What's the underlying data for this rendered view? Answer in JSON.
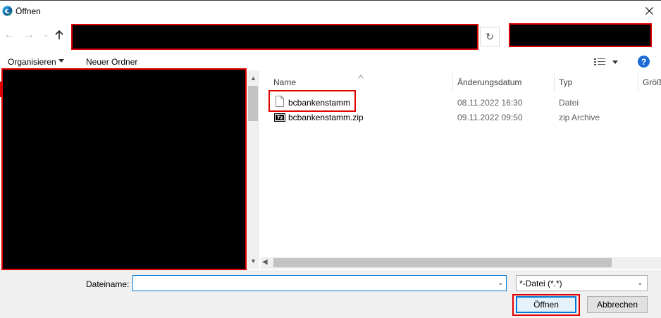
{
  "window": {
    "title": "Öffnen",
    "app_icon": "edge-browser-icon",
    "close_icon": "close-icon"
  },
  "nav": {
    "back_icon": "arrow-left-icon",
    "forward_icon": "arrow-right-icon",
    "recent_icon": "chevron-down-icon",
    "up_icon": "arrow-up-icon",
    "refresh_icon": "refresh-icon",
    "address_redacted": true,
    "search_redacted": true
  },
  "toolbar": {
    "organize_label": "Organisieren",
    "new_folder_label": "Neuer Ordner",
    "view_icon": "details-view-icon",
    "help_label": "?"
  },
  "columns": {
    "name": "Name",
    "date": "Änderungsdatum",
    "type": "Typ",
    "size": "Größe"
  },
  "files": [
    {
      "name": "bcbankenstamm",
      "date": "08.11.2022 16:30",
      "type": "Datei",
      "icon": "file-icon",
      "highlighted": true
    },
    {
      "name": "bcbankenstamm.zip",
      "date": "09.11.2022 09:50",
      "type": "zip Archive",
      "icon": "7zip-archive-icon",
      "highlighted": false
    }
  ],
  "bottom": {
    "filename_label": "Dateiname:",
    "filename_value": "",
    "filter_value": "*-Datei (*.*)",
    "open_label": "Öffnen",
    "cancel_label": "Abbrechen"
  },
  "colors": {
    "accent": "#0078d7",
    "highlight_box": "#e00000",
    "redaction": "#000000",
    "help_blue": "#1a69d6"
  }
}
